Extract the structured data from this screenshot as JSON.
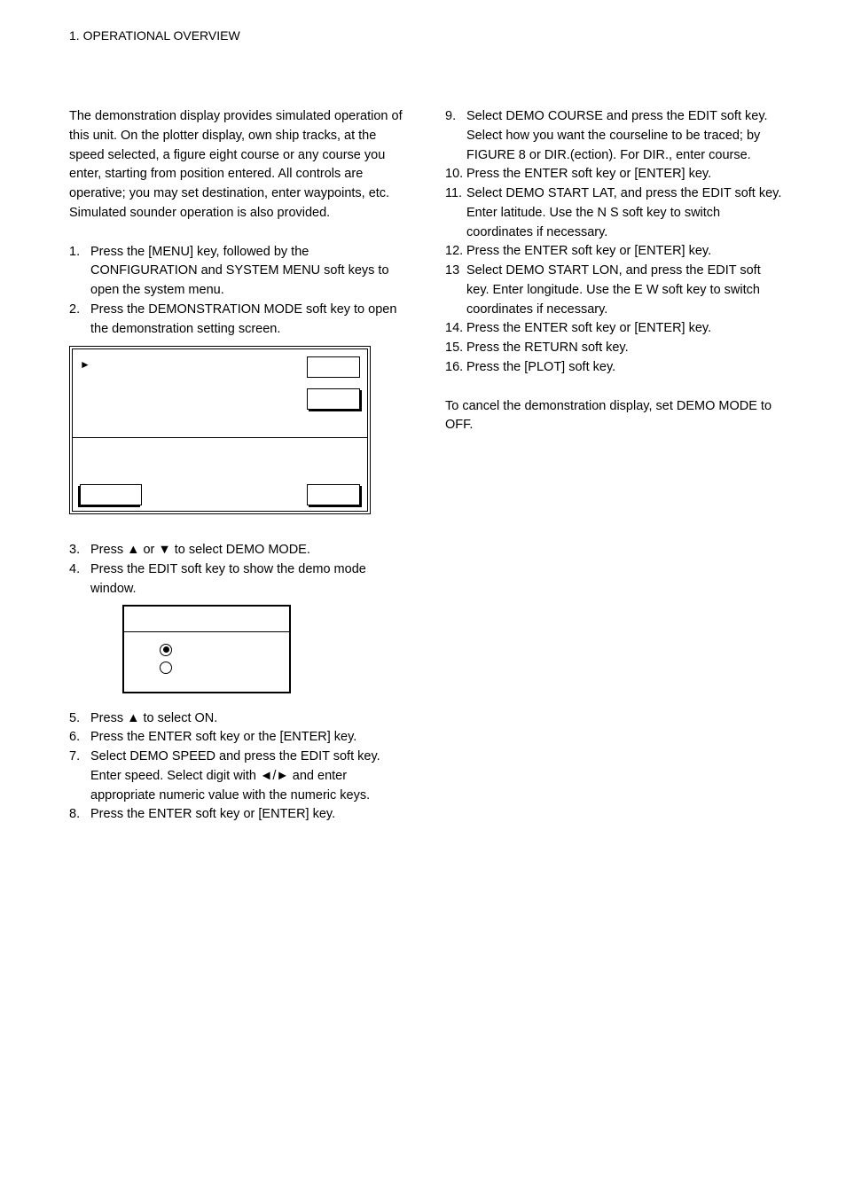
{
  "header": "1. OPERATIONAL OVERVIEW",
  "intro": "The demonstration display provides simulated operation of this unit. On the plotter display, own ship tracks, at the speed selected, a figure eight course or any course you enter, starting from position entered. All controls are operative; you may set destination, enter waypoints, etc. Simulated sounder operation is also provided.",
  "list1": {
    "i1": "Press the [MENU] key, followed by the CONFIGURATION and SYSTEM MENU soft keys to open the system menu.",
    "i2": "Press the DEMONSTRATION MODE soft key to open the demonstration setting screen."
  },
  "list2": {
    "i3": "Press ▲ or ▼ to select DEMO MODE.",
    "i4": "Press the EDIT soft key to show the demo mode window."
  },
  "list3": {
    "i5": "Press ▲ to select ON.",
    "i6": "Press the ENTER soft key or the [ENTER] key.",
    "i7": "Select DEMO SPEED and press the EDIT soft key. Enter speed. Select digit with ◄/► and enter appropriate numeric value with the numeric keys.",
    "i8": "Press the ENTER soft key or [ENTER] key."
  },
  "list4": {
    "i9": "Select DEMO COURSE and press the EDIT soft key. Select how you want the courseline to be traced; by FIGURE 8 or DIR.(ection). For DIR., enter course.",
    "i10": "Press the ENTER soft key or [ENTER] key.",
    "i11": "Select DEMO START LAT, and press the EDIT soft key. Enter latitude. Use the N       S soft key to switch coordinates if necessary.",
    "i12": "Press the ENTER soft key or [ENTER] key.",
    "i13num": "13",
    "i13": "Select DEMO START LON, and press the EDIT soft key. Enter longitude. Use the E       W soft key to switch coordinates if necessary.",
    "i14": "Press the ENTER soft key or [ENTER] key.",
    "i15": "Press the RETURN soft key.",
    "i16": "Press the [PLOT] soft key."
  },
  "nums": {
    "n1": "1.",
    "n2": "2.",
    "n3": "3.",
    "n4": "4.",
    "n5": "5.",
    "n6": "6.",
    "n7": "7.",
    "n8": "8.",
    "n9": "9.",
    "n10": "10.",
    "n11": "11.",
    "n12": "12.",
    "n14": "14.",
    "n15": "15.",
    "n16": "16."
  },
  "closing": "To cancel the demonstration display, set DEMO MODE to OFF.",
  "pointer_glyph": "►"
}
